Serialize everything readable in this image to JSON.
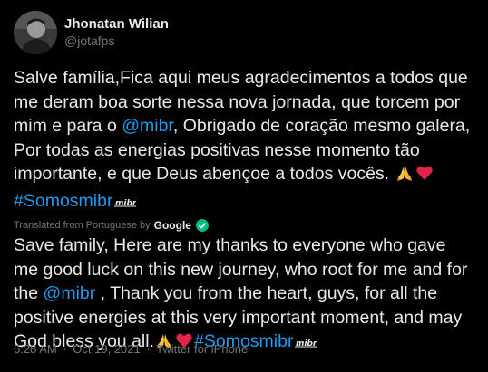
{
  "author": {
    "display_name": "Jhonatan Wilian",
    "handle": "@jotafps"
  },
  "tweet": {
    "original": {
      "text_a": "Salve família,Fica aqui meus agradecimentos a todos que me deram boa sorte nessa nova jornada, que torcem por mim e para o ",
      "mention": "@mibr",
      "text_b": ", Obrigado de coração mesmo galera, Por todas as energias positivas nesse momento tão importante, e que Deus abençoe a todos vocês. ",
      "hashtag": "#Somosmibr"
    },
    "translation_notice": {
      "label": "Translated from Portuguese by",
      "provider": "Google"
    },
    "translation": {
      "text_a": "Save family, Here are my thanks to everyone who gave me good luck on this new journey, who root for me and for the ",
      "mention": "@mibr",
      "text_b": " , Thank you from the heart, guys, for all the positive energies at this very important moment, and may God bless you all.",
      "hashtag": "#Somosmibr"
    },
    "emojis": [
      "folded-hands",
      "red-heart"
    ],
    "hashtag_badge": "mibr"
  },
  "meta": {
    "time": "6:28 AM",
    "date": "Oct 19, 2021",
    "separator": "·",
    "source": "Twitter for iPhone"
  },
  "colors": {
    "background": "#000000",
    "text": "#e7e9ea",
    "secondary": "#71767b",
    "link": "#1d9bf0",
    "heart": "#e0244a",
    "verified_green": "#00ba7c"
  }
}
